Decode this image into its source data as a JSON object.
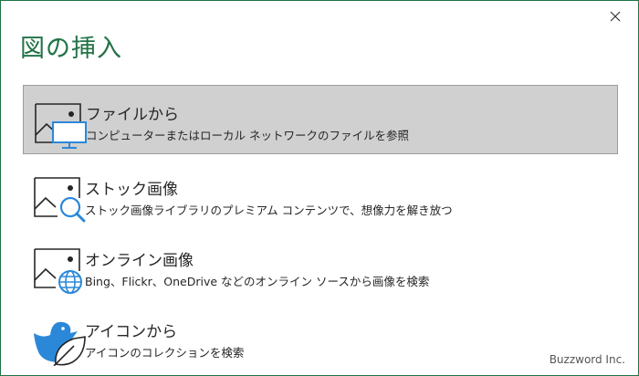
{
  "dialog": {
    "title": "図の挿入",
    "close_icon": "close-icon"
  },
  "options": [
    {
      "label": "ファイルから",
      "description": "コンピューターまたはローカル ネットワークのファイルを参照",
      "icon": "picture-computer-icon",
      "selected": true
    },
    {
      "label": "ストック画像",
      "description": "ストック画像ライブラリのプレミアム コンテンツで、想像力を解き放つ",
      "icon": "picture-search-icon",
      "selected": false
    },
    {
      "label": "オンライン画像",
      "description": "Bing、Flickr、OneDrive などのオンライン ソースから画像を検索",
      "icon": "picture-globe-icon",
      "selected": false
    },
    {
      "label": "アイコンから",
      "description": "アイコンのコレクションを検索",
      "icon": "duck-leaf-icon",
      "selected": false
    }
  ],
  "watermark": "Buzzword Inc.",
  "colors": {
    "accent": "#217346",
    "icon_blue": "#2b88d8",
    "selected_bg": "#d0d0d0",
    "text": "#262626"
  }
}
